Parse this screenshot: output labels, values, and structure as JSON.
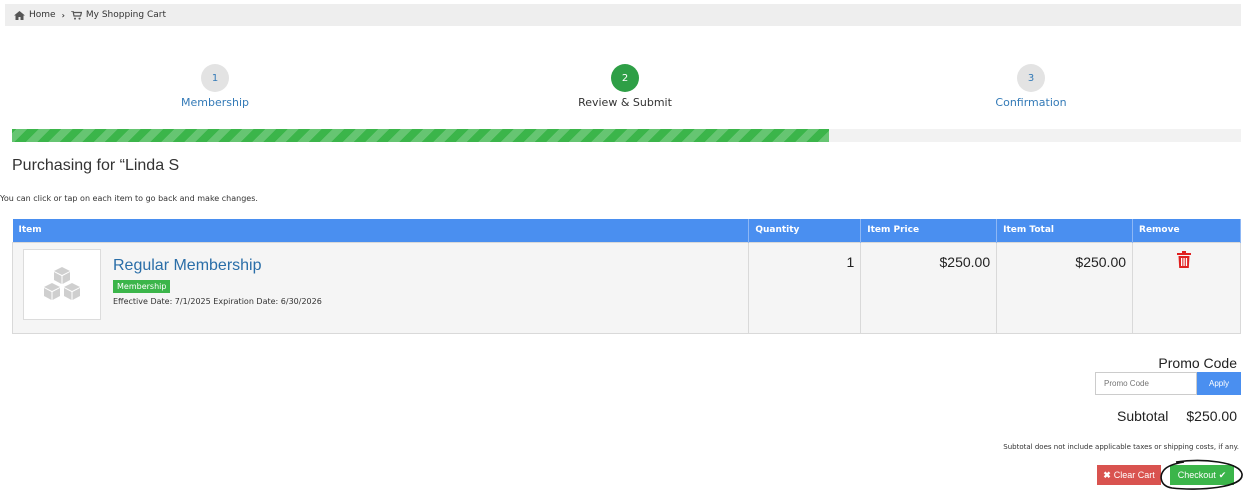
{
  "breadcrumb": {
    "home": "Home",
    "separator": "›",
    "cart": "My Shopping Cart"
  },
  "steps": [
    {
      "number": "1",
      "label": "Membership",
      "state": "link"
    },
    {
      "number": "2",
      "label": "Review & Submit",
      "state": "current"
    },
    {
      "number": "3",
      "label": "Confirmation",
      "state": "link"
    }
  ],
  "progress": {
    "fraction": 0.665
  },
  "purchasing_for": "Purchasing for “Linda S",
  "hint": "You can click or tap on each item to go back and make changes.",
  "table": {
    "headers": [
      "Item",
      "Quantity",
      "Item Price",
      "Item Total",
      "Remove"
    ],
    "rows": [
      {
        "title": "Regular Membership",
        "badge": "Membership",
        "dates": "Effective Date: 7/1/2025 Expiration Date: 6/30/2026",
        "quantity": "1",
        "price": "$250.00",
        "total": "$250.00"
      }
    ]
  },
  "promo": {
    "title": "Promo Code",
    "placeholder": "Promo Code",
    "apply": "Apply"
  },
  "subtotal": {
    "label": "Subtotal",
    "value": "$250.00"
  },
  "note": "Subtotal does not include applicable taxes or shipping costs, if any.",
  "buttons": {
    "clear": "Clear Cart",
    "checkout": "Checkout"
  },
  "colors": {
    "accent": "#4a8ff0",
    "success": "#3bb54a",
    "danger": "#d9534f"
  }
}
